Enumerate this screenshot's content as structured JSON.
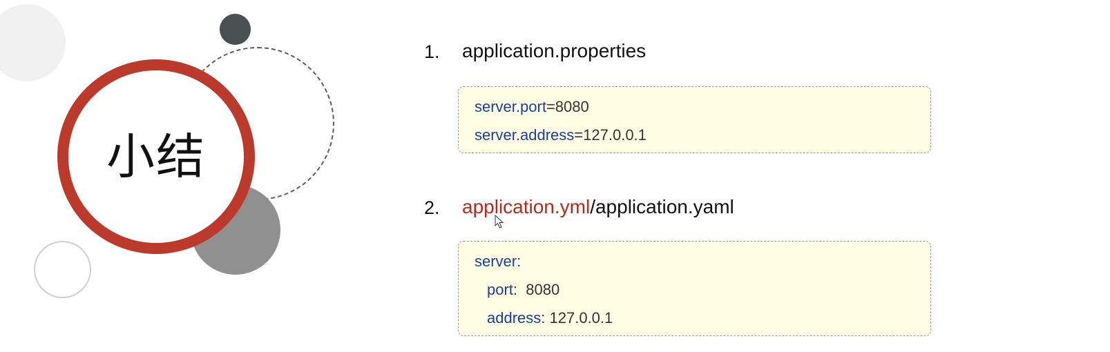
{
  "slide": {
    "title": "小结",
    "items": [
      {
        "number": "1.",
        "title_parts": [
          "application.properties"
        ],
        "code_lines": [
          {
            "key": "server.port",
            "sep": "=",
            "value": "8080"
          },
          {
            "key": "server.address",
            "sep": "=",
            "value": "127.0.0.1"
          }
        ]
      },
      {
        "number": "2.",
        "title_parts": [
          "application.yml",
          "/application.yaml"
        ],
        "code_lines": [
          {
            "key": "server",
            "sep": ":",
            "value": ""
          },
          {
            "key": "port",
            "sep": ":  ",
            "value": "8080"
          },
          {
            "key": "address",
            "sep": ": ",
            "value": "127.0.0.1"
          }
        ]
      }
    ]
  },
  "colors": {
    "accent_red": "#bc3a2b",
    "code_key_blue": "#1c3e9c",
    "code_box_background": "#fffde3",
    "dark_dot": "#4a4f52",
    "gray_circle": "#909090"
  },
  "icons": [
    "mouse-cursor-icon"
  ]
}
